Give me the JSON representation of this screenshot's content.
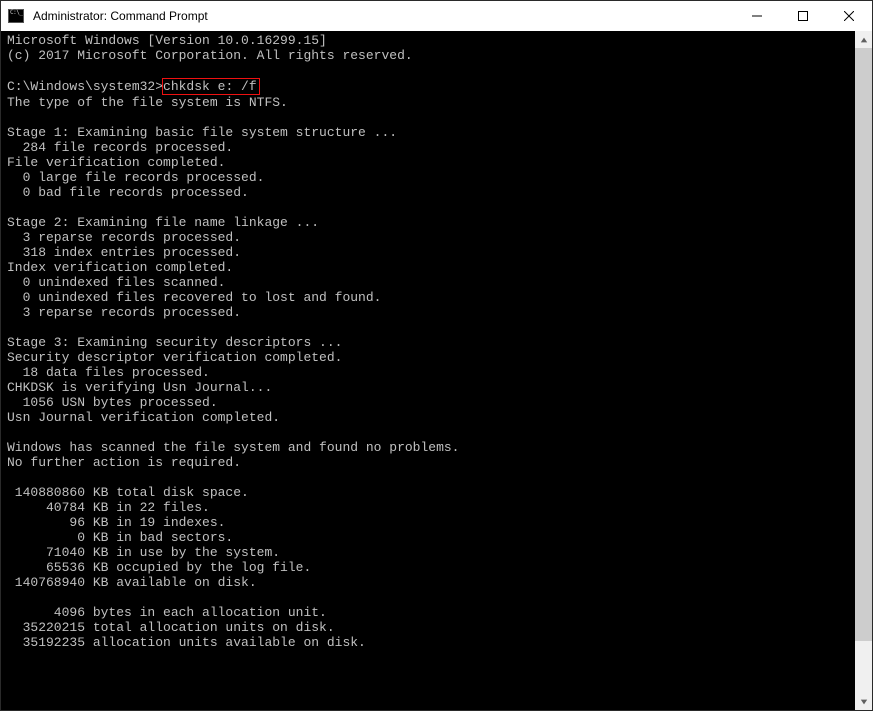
{
  "window": {
    "title": "Administrator: Command Prompt"
  },
  "terminal": {
    "header1": "Microsoft Windows [Version 10.0.16299.15]",
    "header2": "(c) 2017 Microsoft Corporation. All rights reserved.",
    "prompt": "C:\\Windows\\system32>",
    "command": "chkdsk e: /f",
    "line_fs": "The type of the file system is NTFS.",
    "stage1": "Stage 1: Examining basic file system structure ...",
    "s1a": "  284 file records processed.",
    "s1b": "File verification completed.",
    "s1c": "  0 large file records processed.",
    "s1d": "  0 bad file records processed.",
    "stage2": "Stage 2: Examining file name linkage ...",
    "s2a": "  3 reparse records processed.",
    "s2b": "  318 index entries processed.",
    "s2c": "Index verification completed.",
    "s2d": "  0 unindexed files scanned.",
    "s2e": "  0 unindexed files recovered to lost and found.",
    "s2f": "  3 reparse records processed.",
    "stage3": "Stage 3: Examining security descriptors ...",
    "s3a": "Security descriptor verification completed.",
    "s3b": "  18 data files processed.",
    "s3c": "CHKDSK is verifying Usn Journal...",
    "s3d": "  1056 USN bytes processed.",
    "s3e": "Usn Journal verification completed.",
    "summary1": "Windows has scanned the file system and found no problems.",
    "summary2": "No further action is required.",
    "d1": " 140880860 KB total disk space.",
    "d2": "     40784 KB in 22 files.",
    "d3": "        96 KB in 19 indexes.",
    "d4": "         0 KB in bad sectors.",
    "d5": "     71040 KB in use by the system.",
    "d6": "     65536 KB occupied by the log file.",
    "d7": " 140768940 KB available on disk.",
    "a1": "      4096 bytes in each allocation unit.",
    "a2": "  35220215 total allocation units on disk.",
    "a3": "  35192235 allocation units available on disk."
  }
}
